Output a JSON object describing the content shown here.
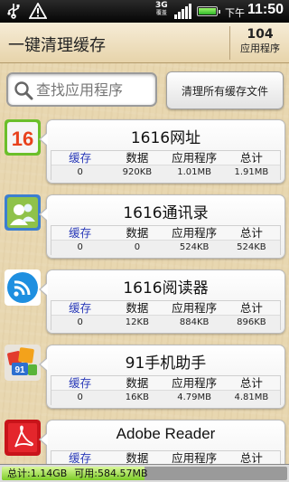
{
  "status_bar": {
    "network": "3G",
    "network_sub": "覆盖",
    "ampm": "下午",
    "time": "11:50",
    "battery_level": 1.0
  },
  "header": {
    "title": "一键清理缓存",
    "app_count": "104",
    "app_count_label": "应用程序"
  },
  "search": {
    "placeholder": "查找应用程序",
    "value": ""
  },
  "clear_all_label": "清理所有缓存文件",
  "columns": [
    "缓存",
    "数据",
    "应用程序",
    "总计"
  ],
  "apps": [
    {
      "name": "1616网址",
      "icon": "1616-web-icon",
      "cache": "0",
      "data": "920KB",
      "app": "1.01MB",
      "total": "1.91MB"
    },
    {
      "name": "1616通讯录",
      "icon": "1616-contacts-icon",
      "cache": "0",
      "data": "0",
      "app": "524KB",
      "total": "524KB"
    },
    {
      "name": "1616阅读器",
      "icon": "1616-reader-icon",
      "cache": "0",
      "data": "12KB",
      "app": "884KB",
      "total": "896KB"
    },
    {
      "name": "91手机助手",
      "icon": "91-assistant-icon",
      "cache": "0",
      "data": "16KB",
      "app": "4.79MB",
      "total": "4.81MB"
    },
    {
      "name": "Adobe Reader",
      "icon": "adobe-reader-icon",
      "cache": "",
      "data": "",
      "app": "",
      "total": ""
    }
  ],
  "storage": {
    "total_label": "总计:1.14GB",
    "free_label": "可用:584.57MB",
    "used_fraction": 0.5
  },
  "colors": {
    "accent_blue": "#2a3ab8",
    "background": "#e8d7b0",
    "storage_fill": "#7dcc28"
  }
}
